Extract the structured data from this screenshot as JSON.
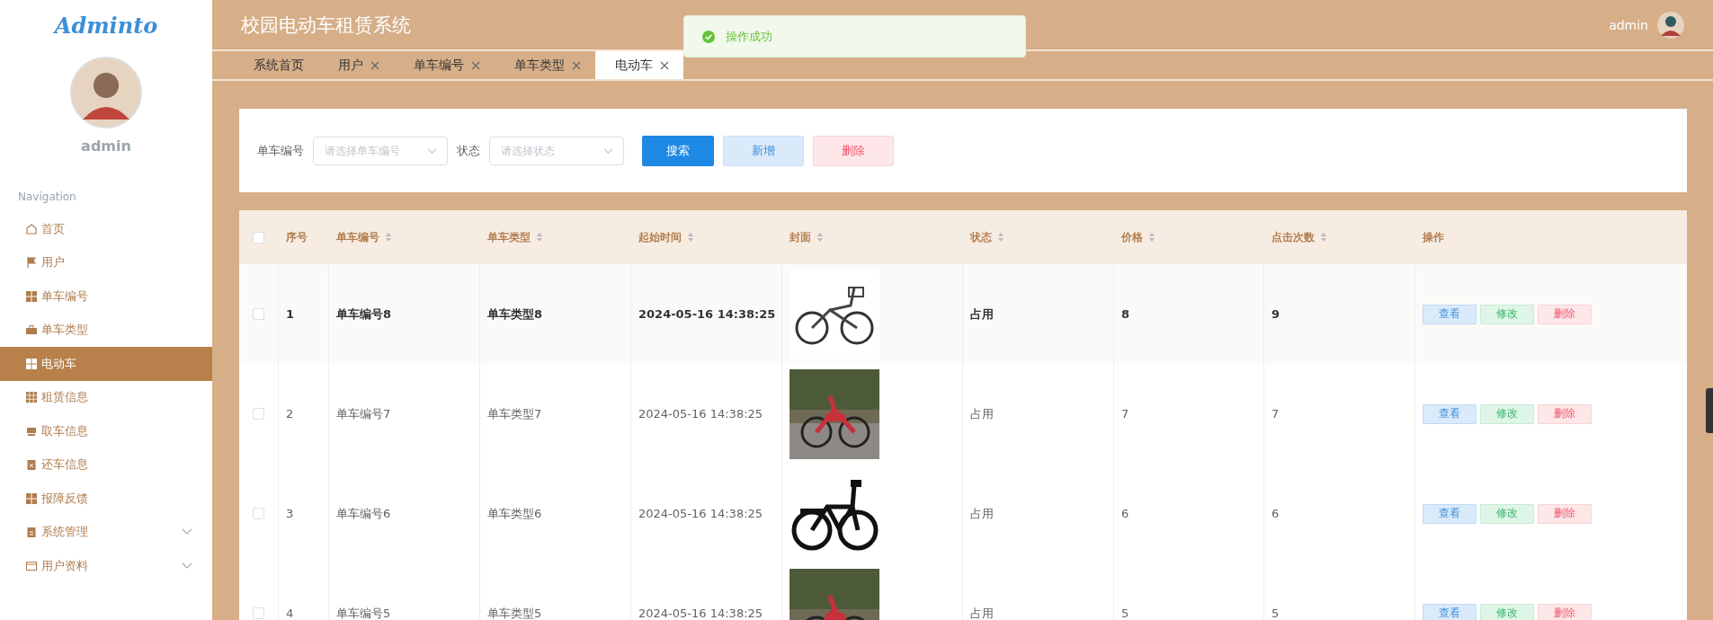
{
  "sidebar": {
    "logo": "Adminto",
    "user": "admin",
    "section": "Navigation",
    "items": [
      {
        "label": "首页",
        "selected": false,
        "expandable": false
      },
      {
        "label": "用户",
        "selected": false,
        "expandable": false
      },
      {
        "label": "单车编号",
        "selected": false,
        "expandable": false
      },
      {
        "label": "单车类型",
        "selected": false,
        "expandable": false
      },
      {
        "label": "电动车",
        "selected": true,
        "expandable": false
      },
      {
        "label": "租赁信息",
        "selected": false,
        "expandable": false
      },
      {
        "label": "取车信息",
        "selected": false,
        "expandable": false
      },
      {
        "label": "还车信息",
        "selected": false,
        "expandable": false
      },
      {
        "label": "报障反馈",
        "selected": false,
        "expandable": false
      },
      {
        "label": "系统管理",
        "selected": false,
        "expandable": true
      },
      {
        "label": "用户资料",
        "selected": false,
        "expandable": true
      }
    ]
  },
  "header": {
    "title": "校园电动车租赁系统",
    "user": "admin"
  },
  "toast": {
    "message": "操作成功"
  },
  "tabs": [
    {
      "label": "系统首页",
      "closable": false,
      "selected": false
    },
    {
      "label": "用户",
      "closable": true,
      "selected": false
    },
    {
      "label": "单车编号",
      "closable": true,
      "selected": false
    },
    {
      "label": "单车类型",
      "closable": true,
      "selected": false
    },
    {
      "label": "电动车",
      "closable": true,
      "selected": true
    }
  ],
  "filters": [
    {
      "label": "单车编号",
      "placeholder": "请选择单车编号"
    },
    {
      "label": "状态",
      "placeholder": "请选择状态"
    }
  ],
  "buttons": [
    {
      "label": "搜索",
      "kind": "primary"
    },
    {
      "label": "新增",
      "kind": "add"
    },
    {
      "label": "删除",
      "kind": "delete"
    }
  ],
  "table": {
    "header_checked": false,
    "columns": [
      {
        "label": "序号",
        "sortable": false
      },
      {
        "label": "单车编号",
        "sortable": true
      },
      {
        "label": "单车类型",
        "sortable": true
      },
      {
        "label": "起始时间",
        "sortable": true
      },
      {
        "label": "封面",
        "sortable": true
      },
      {
        "label": "状态",
        "sortable": true
      },
      {
        "label": "价格",
        "sortable": true
      },
      {
        "label": "点击次数",
        "sortable": true
      },
      {
        "label": "操作",
        "sortable": false
      }
    ],
    "rows": [
      {
        "checked": false,
        "hovered": true,
        "cells": [
          "1",
          "单车编号8",
          "单车类型8",
          "2024-05-16 14:38:25",
          "",
          "占用",
          "8",
          "9"
        ],
        "actions": [
          "查看",
          "修改",
          "删除"
        ]
      },
      {
        "checked": false,
        "hovered": false,
        "cells": [
          "2",
          "单车编号7",
          "单车类型7",
          "2024-05-16 14:38:25",
          "",
          "占用",
          "7",
          "7"
        ],
        "actions": [
          "查看",
          "修改",
          "删除"
        ]
      },
      {
        "checked": false,
        "hovered": false,
        "cells": [
          "3",
          "单车编号6",
          "单车类型6",
          "2024-05-16 14:38:25",
          "",
          "占用",
          "6",
          "6"
        ],
        "actions": [
          "查看",
          "修改",
          "删除"
        ]
      },
      {
        "checked": false,
        "hovered": false,
        "cells": [
          "4",
          "单车编号5",
          "单车类型5",
          "2024-05-16 14:38:25",
          "",
          "占用",
          "5",
          "5"
        ],
        "actions": [
          "查看",
          "修改",
          "删除"
        ]
      }
    ]
  }
}
